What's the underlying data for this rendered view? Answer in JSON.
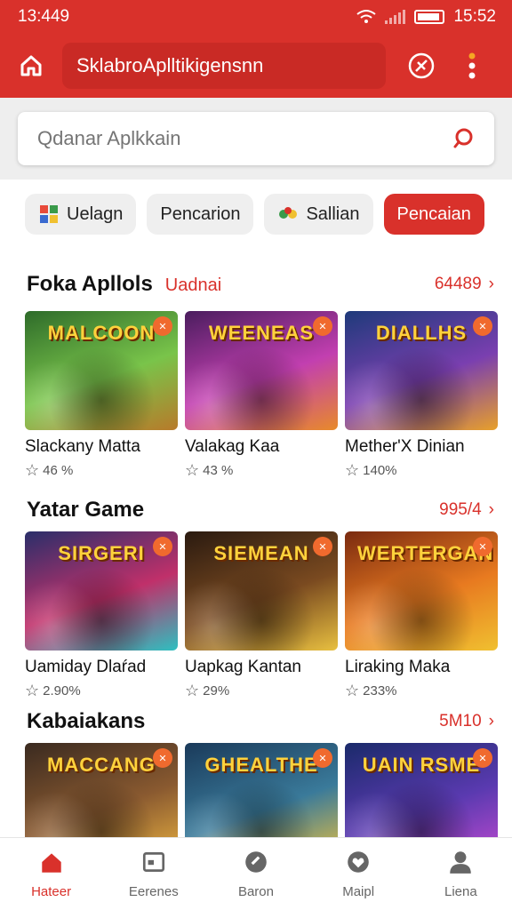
{
  "status": {
    "time": "13:449",
    "clock": "15:52"
  },
  "appbar": {
    "title": "SklabroAplltikigensnn"
  },
  "search": {
    "placeholder": "Qdanar Aplkkain"
  },
  "chips": [
    {
      "label": "Uelagn",
      "icon": "blocks-icon"
    },
    {
      "label": "Pencarion"
    },
    {
      "label": "Sallian",
      "icon": "gamepad-icon"
    },
    {
      "label": "Pencaian",
      "active": true
    }
  ],
  "sections": [
    {
      "title": "Foka Apllols",
      "subtitle": "Uadnai",
      "more": "64489",
      "cards": [
        {
          "name": "Slackany Matta",
          "rating": "46 %",
          "logo": "MALCOON",
          "colors": [
            "#2e6b2a",
            "#79c44a",
            "#b87a2a"
          ]
        },
        {
          "name": "Valakag Kaa",
          "rating": "43 %",
          "logo": "WEENEAS",
          "colors": [
            "#4a1d5e",
            "#c23fb0",
            "#e88a2a"
          ]
        },
        {
          "name": "Mether'X Dinian",
          "rating": "140%",
          "logo": "DIALLHS",
          "colors": [
            "#1e3a7a",
            "#7a3fb0",
            "#e8a02a"
          ]
        }
      ]
    },
    {
      "title": "Yatar Game",
      "subtitle": "",
      "more": "995/4",
      "cards": [
        {
          "name": "Uamiday Dlaŕad",
          "rating": "2.90%",
          "logo": "SIRGERI",
          "colors": [
            "#2a2f6a",
            "#c0306a",
            "#2ec0c0"
          ]
        },
        {
          "name": "Uapkag Kantan",
          "rating": "29%",
          "logo": "SIEMEAN",
          "colors": [
            "#2a1a10",
            "#7a4a20",
            "#e8c040"
          ]
        },
        {
          "name": "Liraking Maka",
          "rating": "233%",
          "logo": "WERTERGAN",
          "colors": [
            "#7a2a10",
            "#e87a20",
            "#f0c030"
          ]
        }
      ]
    },
    {
      "title": "Kabaiakans",
      "subtitle": "",
      "more": "5M10",
      "cards": [
        {
          "name": "",
          "rating": "",
          "logo": "MACCANG",
          "colors": [
            "#3a2a20",
            "#8a5a30",
            "#e8b040"
          ]
        },
        {
          "name": "",
          "rating": "",
          "logo": "GHEALTHE",
          "colors": [
            "#1a3a5a",
            "#3a7a9a",
            "#e8c040"
          ]
        },
        {
          "name": "",
          "rating": "",
          "logo": "UAIN RSME",
          "colors": [
            "#1a2a6a",
            "#5a3ab0",
            "#c04ad0"
          ]
        }
      ]
    }
  ],
  "nav": [
    {
      "label": "Hateer",
      "icon": "home-icon",
      "active": true
    },
    {
      "label": "Eerenes",
      "icon": "apps-icon"
    },
    {
      "label": "Baron",
      "icon": "games-icon"
    },
    {
      "label": "Maipl",
      "icon": "heart-icon"
    },
    {
      "label": "Liena",
      "icon": "person-icon"
    }
  ],
  "colors": {
    "brand": "#d9312b",
    "badge": "#f06a2e"
  }
}
